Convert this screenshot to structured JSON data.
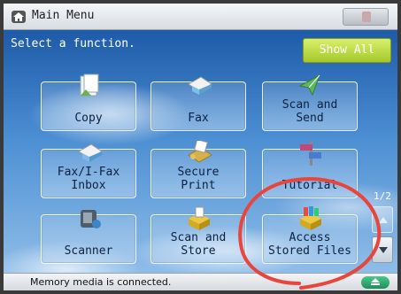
{
  "titlebar": {
    "title": "Main Menu",
    "icon": "home-icon"
  },
  "prompt": "Select a function.",
  "show_all_label": "Show All",
  "functions": [
    {
      "label": "Copy",
      "icon": "copy-icon"
    },
    {
      "label": "Fax",
      "icon": "fax-icon"
    },
    {
      "label": "Scan and\nSend",
      "icon": "scan-send-icon"
    },
    {
      "label": "Fax/I-Fax\nInbox",
      "icon": "fax-inbox-icon"
    },
    {
      "label": "Secure\nPrint",
      "icon": "secure-print-icon"
    },
    {
      "label": "Tutorial",
      "icon": "tutorial-icon"
    },
    {
      "label": "Scanner",
      "icon": "scanner-icon"
    },
    {
      "label": "Scan and\nStore",
      "icon": "scan-store-icon"
    },
    {
      "label": "Access\nStored Files",
      "icon": "stored-files-icon"
    }
  ],
  "pager": {
    "indicator": "1/2"
  },
  "status": {
    "text": "Memory media is connected.",
    "eject_icon": "eject-icon"
  },
  "colors": {
    "show_all": "#b6d63a",
    "annotation": "#e8453c",
    "eject": "#2aa86b"
  }
}
